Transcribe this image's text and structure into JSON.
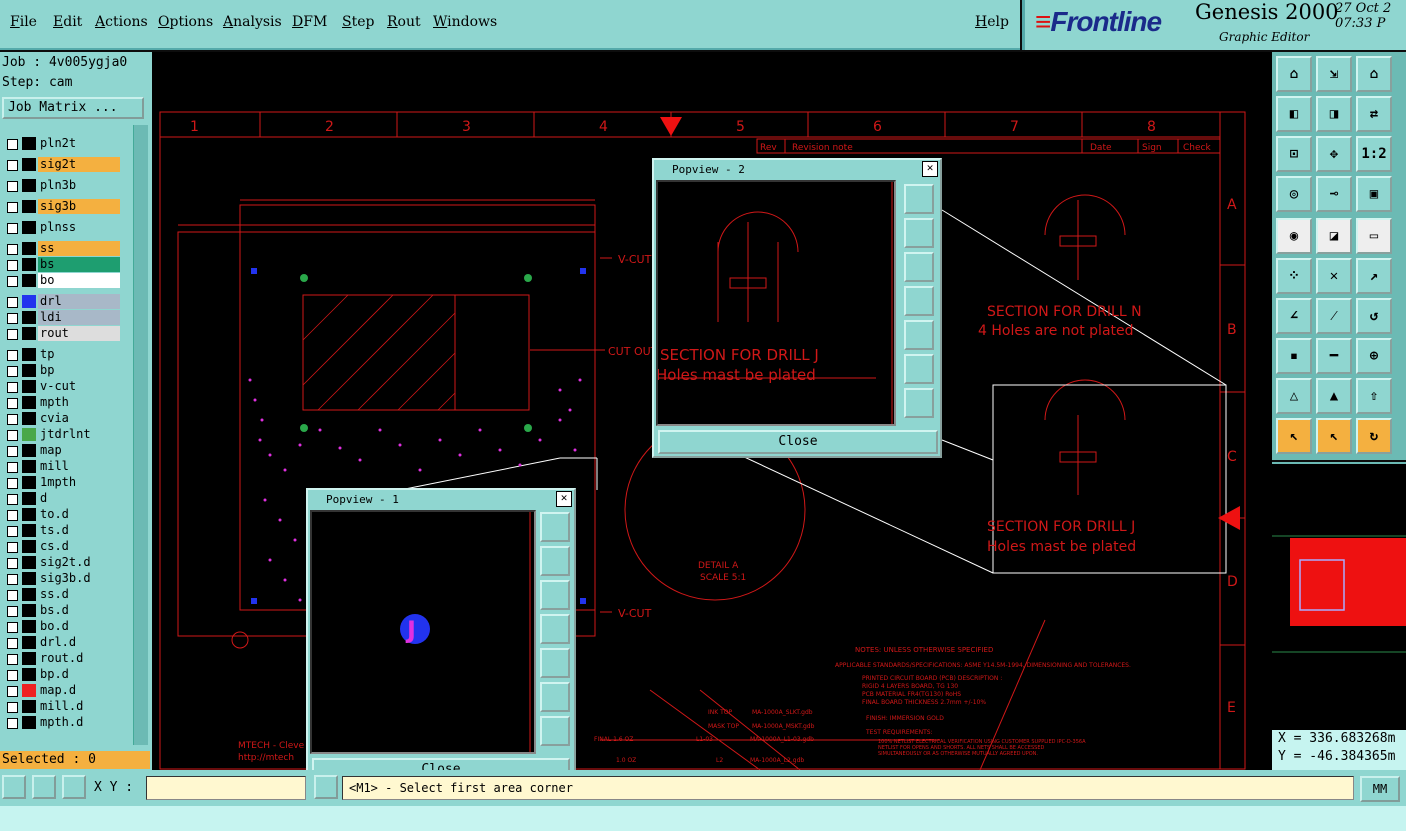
{
  "menu": [
    "File",
    "Edit",
    "Actions",
    "Options",
    "Analysis",
    "DFM",
    "Step",
    "Rout",
    "Windows",
    "Help"
  ],
  "brand": {
    "logo": "Frontline",
    "title": "Genesis 2000",
    "subtitle": "Graphic Editor",
    "date": "27 Oct 2",
    "time": "07:33 P"
  },
  "job": {
    "job_label": "Job : 4v005ygja0",
    "step_label": "Step: cam",
    "matrix_button": "Job Matrix ..."
  },
  "layers": [
    {
      "name": "pln2t",
      "color": "#8fd6d0",
      "swatch": "#000"
    },
    {
      "name": "sig2t",
      "color": "#f4b040",
      "swatch": "#000"
    },
    {
      "name": "pln3b",
      "color": "#8fd6d0",
      "swatch": "#000"
    },
    {
      "name": "sig3b",
      "color": "#f4b040",
      "swatch": "#000"
    },
    {
      "name": "plnss",
      "color": "#8fd6d0",
      "swatch": "#000"
    },
    {
      "name": "ss",
      "color": "#f4b040",
      "swatch": "#000"
    },
    {
      "name": "bs",
      "color": "#1e9e70",
      "swatch": "#000"
    },
    {
      "name": "bo",
      "color": "#ffffff",
      "swatch": "#000"
    },
    {
      "name": "drl",
      "color": "#a8b8c8",
      "swatch": "#2233ee"
    },
    {
      "name": "ldi",
      "color": "#a8b8c8",
      "swatch": "#000"
    },
    {
      "name": "rout",
      "color": "#dddddd",
      "swatch": "#000"
    },
    {
      "name": "tp",
      "color": "#8fd6d0",
      "swatch": "#000"
    },
    {
      "name": "bp",
      "color": "#8fd6d0",
      "swatch": "#000"
    },
    {
      "name": "v-cut",
      "color": "#8fd6d0",
      "swatch": "#000"
    },
    {
      "name": "mpth",
      "color": "#8fd6d0",
      "swatch": "#000"
    },
    {
      "name": "cvia",
      "color": "#8fd6d0",
      "swatch": "#000"
    },
    {
      "name": "jtdrlnt",
      "color": "#8fd6d0",
      "swatch": "#4aa84a"
    },
    {
      "name": "map",
      "color": "#8fd6d0",
      "swatch": "#000"
    },
    {
      "name": "mill",
      "color": "#8fd6d0",
      "swatch": "#000"
    },
    {
      "name": "1mpth",
      "color": "#8fd6d0",
      "swatch": "#000"
    },
    {
      "name": "d",
      "color": "#8fd6d0",
      "swatch": "#000"
    },
    {
      "name": "to.d",
      "color": "#8fd6d0",
      "swatch": "#000"
    },
    {
      "name": "ts.d",
      "color": "#8fd6d0",
      "swatch": "#000"
    },
    {
      "name": "cs.d",
      "color": "#8fd6d0",
      "swatch": "#000"
    },
    {
      "name": "sig2t.d",
      "color": "#8fd6d0",
      "swatch": "#000"
    },
    {
      "name": "sig3b.d",
      "color": "#8fd6d0",
      "swatch": "#000"
    },
    {
      "name": "ss.d",
      "color": "#8fd6d0",
      "swatch": "#000"
    },
    {
      "name": "bs.d",
      "color": "#8fd6d0",
      "swatch": "#000"
    },
    {
      "name": "bo.d",
      "color": "#8fd6d0",
      "swatch": "#000"
    },
    {
      "name": "drl.d",
      "color": "#8fd6d0",
      "swatch": "#000"
    },
    {
      "name": "rout.d",
      "color": "#8fd6d0",
      "swatch": "#000"
    },
    {
      "name": "bp.d",
      "color": "#8fd6d0",
      "swatch": "#000"
    },
    {
      "name": "map.d",
      "color": "#8fd6d0",
      "swatch": "#ee2222"
    },
    {
      "name": "mill.d",
      "color": "#8fd6d0",
      "swatch": "#000"
    },
    {
      "name": "mpth.d",
      "color": "#8fd6d0",
      "swatch": "#000"
    }
  ],
  "selected": "Selected : 0",
  "bottom": {
    "xy_label": "X Y :",
    "xy_value": "",
    "message": "<M1> - Select first area corner",
    "units": "MM"
  },
  "coords": {
    "x": "X = 336.683268m",
    "y": "Y = -46.384365m"
  },
  "popup1": {
    "title": "Popview - 1",
    "close": "Close",
    "letter": "J"
  },
  "popup2": {
    "title": "Popview - 2",
    "close": "Close",
    "section": "SECTION FOR DRILL J",
    "note": "Holes mast be plated"
  },
  "drawing": {
    "columns": [
      "1",
      "2",
      "3",
      "4",
      "5",
      "6",
      "7",
      "8"
    ],
    "rows": [
      "A",
      "B",
      "C",
      "D",
      "E"
    ],
    "revision": [
      "Rev",
      "Revision note",
      "Date",
      "Sign",
      "Check"
    ],
    "vcut": "V-CUT",
    "cutout": "CUT OUT",
    "section_n": "SECTION FOR DRILL N",
    "section_n_note": "4 Holes are not plated",
    "section_j": "SECTION FOR DRILL J",
    "section_j_note": "Holes mast be plated",
    "detail": "DETAIL A",
    "scale": "SCALE 5:1",
    "notes_title": "NOTES: UNLESS OTHERWISE SPECIFIED",
    "notes": [
      "APPLICABLE STANDARDS/SPECIFICATIONS: ASME Y14.5M-1994, DIMENSIONING AND TOLERANCES.",
      "PRINTED CIRCUIT BOARD (PCB) DESCRIPTION :",
      "RIGID 4 LAYERS BOARD, TG 130",
      "PCB MATERIAL FR4(TG130) RoHS",
      "FINAL BOARD THICKNESS 2.7mm +/-10%",
      "FINISH: IMMERSION GOLD",
      "TEST REQUIREMENTS:",
      "100% NETLIST ELECTRICAL VERIFICATION USING CUSTOMER SUPPLIED IPC-D-356A",
      "NETLIST FOR OPENS AND SHORTS. ALL NETS SHALL BE ACCESSED",
      "SIMULTANEOUSLY OR AS OTHERWISE MUTUALLY AGREED UPON."
    ],
    "stack": [
      {
        "label": "INK TOP",
        "file": "MA-1000A_SLKT.gdb"
      },
      {
        "label": "MASK TOP",
        "file": "MA-1000A_MSKT.gdb"
      },
      {
        "label": "FINAL 1.6 OZ",
        "file": "MA-1000A_L1-03.gdb"
      },
      {
        "label": "1.0 OZ",
        "file": "MA-1000A_L2.gdb"
      }
    ],
    "layer_codes": [
      "L1-03",
      "L2"
    ],
    "title_block": "MTECH - Cleve",
    "url": "http://mtech"
  }
}
